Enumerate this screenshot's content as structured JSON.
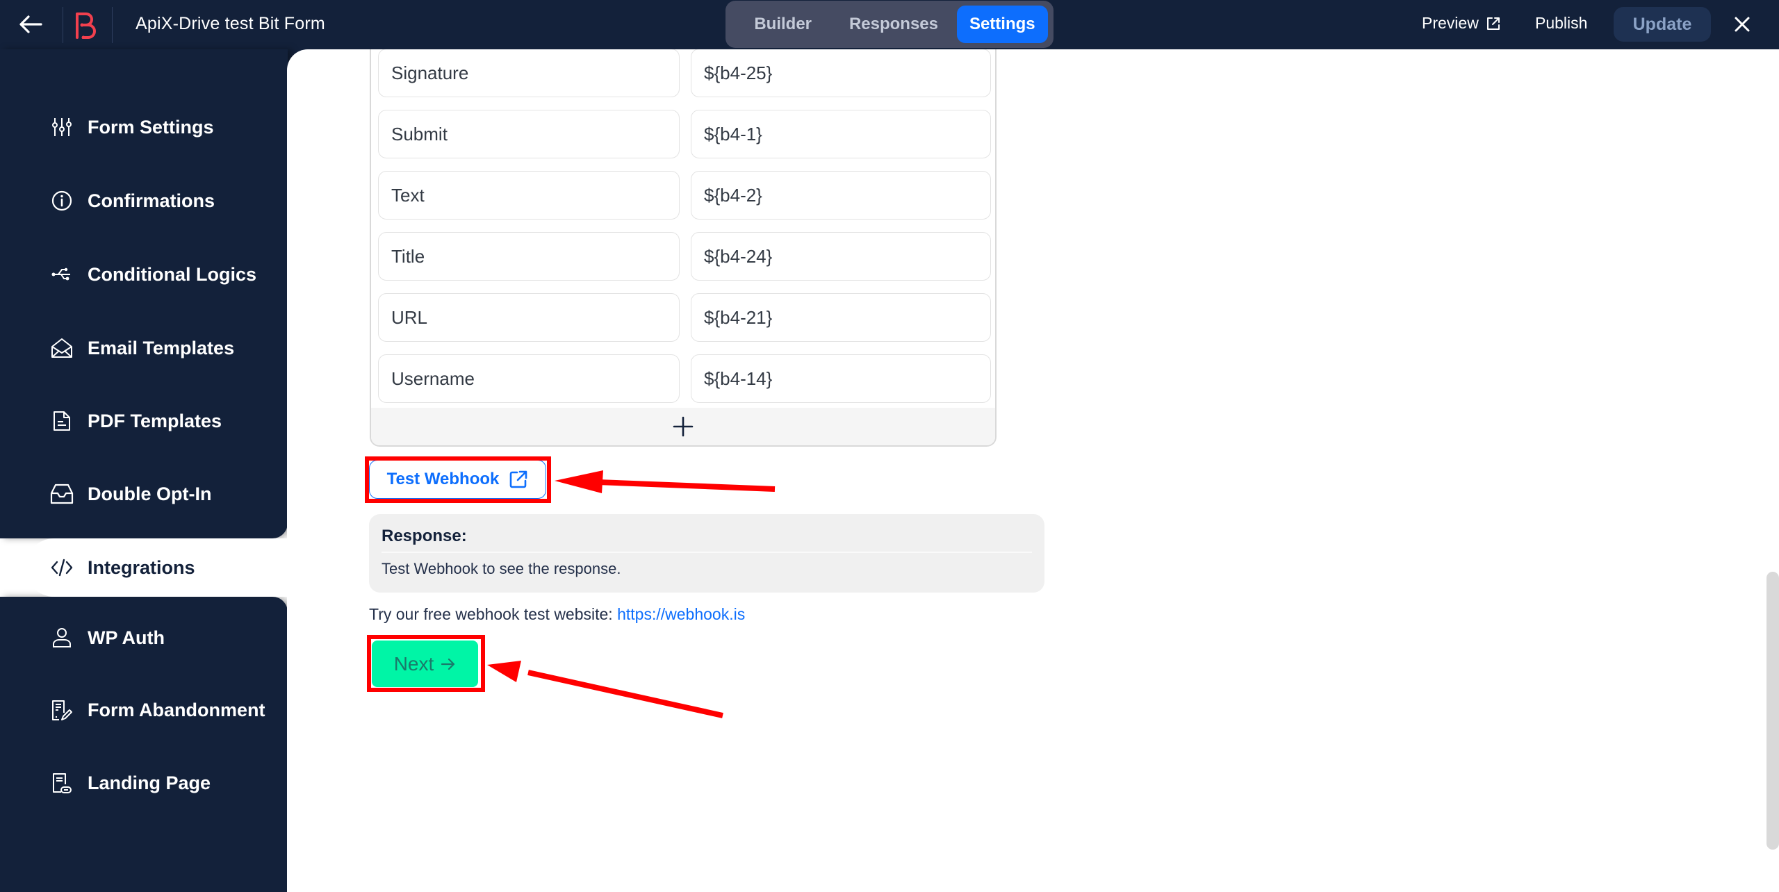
{
  "header": {
    "back_icon": "arrow-left-icon",
    "logo_icon": "bitform-logo-icon",
    "title": "ApiX-Drive test Bit Form",
    "tabs": [
      {
        "label": "Builder",
        "active": false
      },
      {
        "label": "Responses",
        "active": false
      },
      {
        "label": "Settings",
        "active": true
      }
    ],
    "preview_label": "Preview",
    "preview_icon": "external-link-icon",
    "publish_label": "Publish",
    "update_label": "Update",
    "close_icon": "close-icon"
  },
  "sidebar": {
    "items": [
      {
        "label": "Form Settings",
        "icon": "sliders-icon",
        "active": false
      },
      {
        "label": "Confirmations",
        "icon": "info-circle-icon",
        "active": false
      },
      {
        "label": "Conditional Logics",
        "icon": "usb-branch-icon",
        "active": false
      },
      {
        "label": "Email Templates",
        "icon": "open-envelope-icon",
        "active": false
      },
      {
        "label": "PDF Templates",
        "icon": "document-icon",
        "active": false
      },
      {
        "label": "Double Opt-In",
        "icon": "inbox-icon",
        "active": false
      },
      {
        "label": "Integrations",
        "icon": "code-icon",
        "active": true
      },
      {
        "label": "WP Auth",
        "icon": "user-icon",
        "active": false
      },
      {
        "label": "Form Abandonment",
        "icon": "form-edit-icon",
        "active": false
      },
      {
        "label": "Landing Page",
        "icon": "page-link-icon",
        "active": false
      }
    ]
  },
  "mapping": {
    "rows": [
      {
        "key": "Signature",
        "value": "${b4-25}"
      },
      {
        "key": "Submit",
        "value": "${b4-1}"
      },
      {
        "key": "Text",
        "value": "${b4-2}"
      },
      {
        "key": "Title",
        "value": "${b4-24}"
      },
      {
        "key": "URL",
        "value": "${b4-21}"
      },
      {
        "key": "Username",
        "value": "${b4-14}"
      }
    ],
    "add_icon": "plus-icon"
  },
  "webhook": {
    "test_label": "Test Webhook",
    "test_icon": "external-link-icon",
    "response_label": "Response:",
    "response_text": "Test Webhook to see the response.",
    "try_text": "Try our free webhook test website: ",
    "try_link": "https://webhook.is",
    "next_label": "Next",
    "next_icon": "arrow-right-icon"
  },
  "colors": {
    "primary": "#0d6efd",
    "sidebar_bg": "#13213a",
    "next_button": "#00f5a6",
    "annotation": "#ff0000",
    "logo": "#f2404e"
  }
}
